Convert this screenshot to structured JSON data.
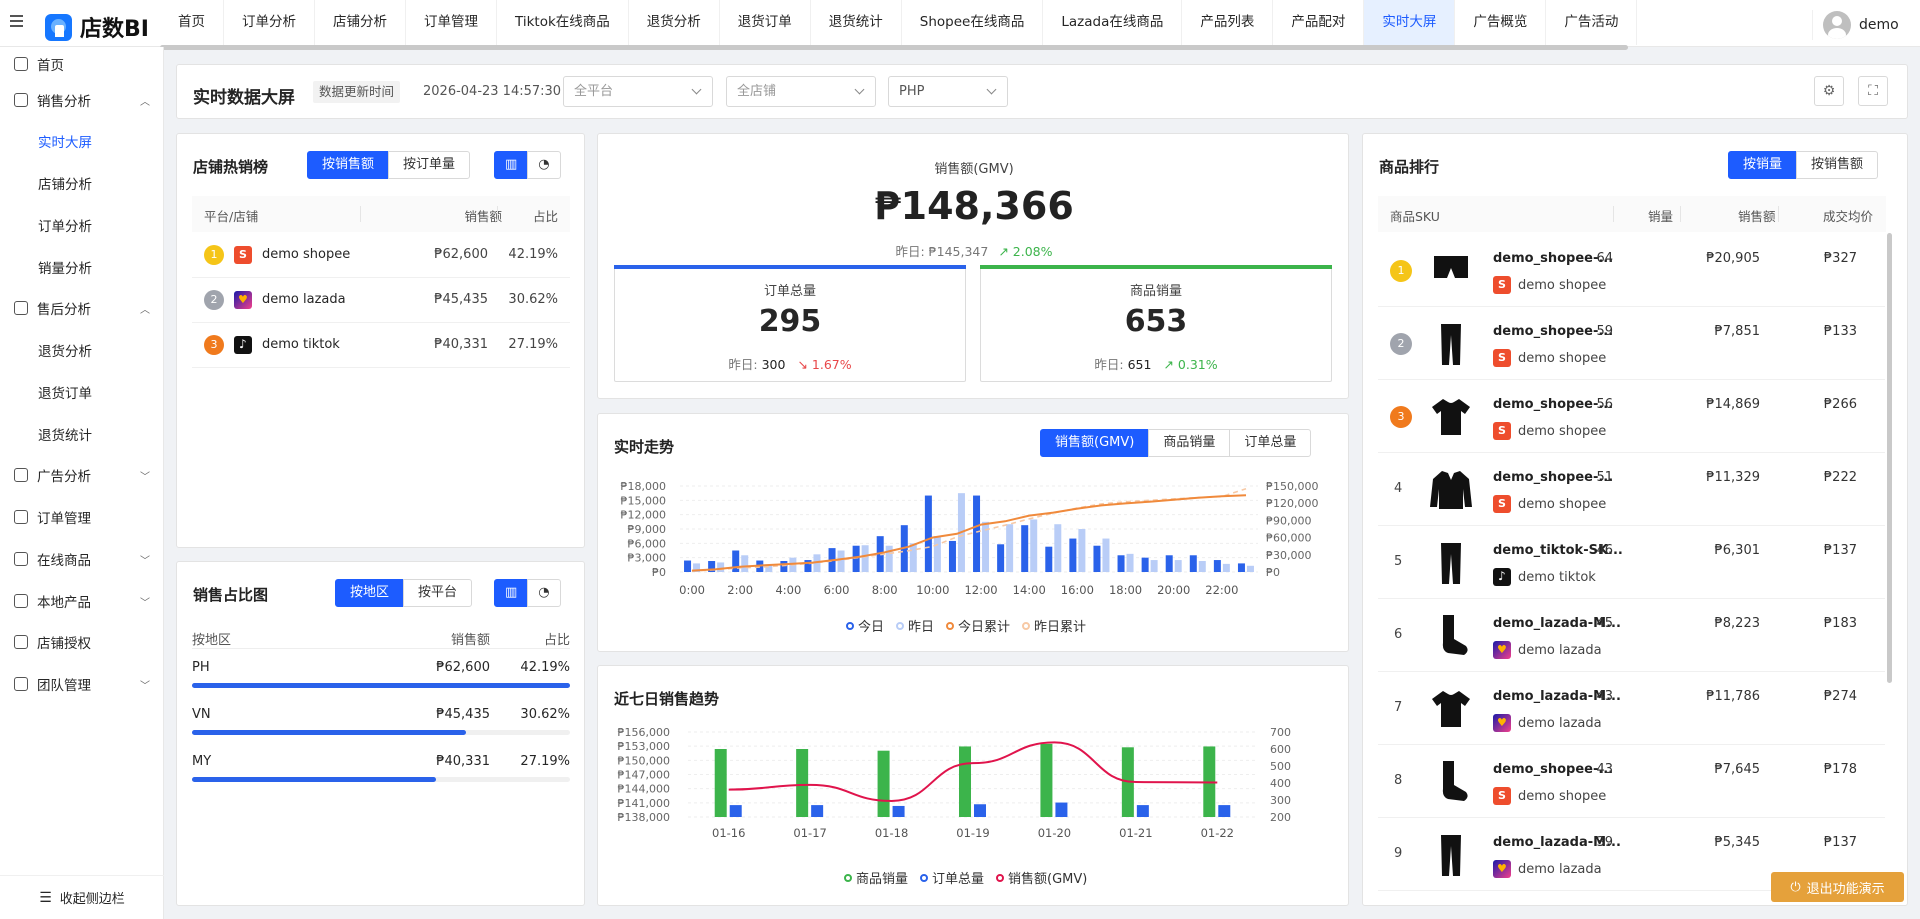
{
  "app": {
    "logo_text": "店数BI",
    "username": "demo"
  },
  "nav": [
    "首页",
    "订单分析",
    "店铺分析",
    "订单管理",
    "Tiktok在线商品",
    "退货分析",
    "退货订单",
    "退货统计",
    "Shopee在线商品",
    "Lazada在线商品",
    "产品列表",
    "产品配对",
    "实时大屏",
    "广告概览",
    "广告活动"
  ],
  "nav_active": "实时大屏",
  "sidebar": {
    "items": [
      {
        "label": "首页",
        "icon": "home-icon"
      },
      {
        "label": "销售分析",
        "icon": "sales-icon"
      },
      {
        "label": "实时大屏"
      },
      {
        "label": "店铺分析"
      },
      {
        "label": "订单分析"
      },
      {
        "label": "销量分析"
      },
      {
        "label": "售后分析",
        "icon": "aftersale-icon"
      },
      {
        "label": "退货分析"
      },
      {
        "label": "退货订单"
      },
      {
        "label": "退货统计"
      },
      {
        "label": "广告分析",
        "icon": "ad-icon"
      },
      {
        "label": "订单管理",
        "icon": "order-icon"
      },
      {
        "label": "在线商品",
        "icon": "store-icon"
      },
      {
        "label": "本地产品",
        "icon": "box-icon"
      },
      {
        "label": "店铺授权",
        "icon": "shield-icon"
      },
      {
        "label": "团队管理",
        "icon": "team-icon"
      }
    ],
    "collapse_label": "收起侧边栏"
  },
  "header": {
    "title": "实时数据大屏",
    "update_tag": "数据更新时间",
    "update_time": "2026-04-23 14:57:30",
    "platform_placeholder": "全平台",
    "shop_placeholder": "全店铺",
    "currency": "PHP"
  },
  "hot_shops": {
    "title": "店铺热销榜",
    "toggle": [
      "按销售额",
      "按订单量"
    ],
    "columns": [
      "平台/店铺",
      "销售额",
      "占比"
    ],
    "rows": [
      {
        "rank": "1",
        "platform": "shopee",
        "name": "demo shopee",
        "sales": "₱62,600",
        "pct": "42.19%"
      },
      {
        "rank": "2",
        "platform": "lazada",
        "name": "demo lazada",
        "sales": "₱45,435",
        "pct": "30.62%"
      },
      {
        "rank": "3",
        "platform": "tiktok",
        "name": "demo tiktok",
        "sales": "₱40,331",
        "pct": "27.19%"
      }
    ]
  },
  "share": {
    "title": "销售占比图",
    "toggle": [
      "按地区",
      "按平台"
    ],
    "columns": [
      "按地区",
      "销售额",
      "占比"
    ],
    "rows": [
      {
        "name": "PH",
        "sales": "₱62,600",
        "pct": "42.19%",
        "fraction": 0.4219
      },
      {
        "name": "VN",
        "sales": "₱45,435",
        "pct": "30.62%",
        "fraction": 0.3062
      },
      {
        "name": "MY",
        "sales": "₱40,331",
        "pct": "27.19%",
        "fraction": 0.2719
      }
    ]
  },
  "kpi": {
    "gmv_label": "销售额(GMV)",
    "gmv_value": "₱148,366",
    "gmv_yesterday": "昨日: ₱145,347",
    "gmv_change": "2.08%",
    "orders_label": "订单总量",
    "orders_value": "295",
    "orders_yesterday_label": "昨日:",
    "orders_yesterday": "300",
    "orders_change": "1.67%",
    "units_label": "商品销量",
    "units_value": "653",
    "units_yesterday_label": "昨日:",
    "units_yesterday": "651",
    "units_change": "0.31%",
    "colors": {
      "orders_bar": "#2a62ea",
      "units_bar": "#3cb44b"
    }
  },
  "realtime": {
    "title": "实时走势",
    "toggle": [
      "销售额(GMV)",
      "商品销量",
      "订单总量"
    ]
  },
  "weekly": {
    "title": "近七日销售趋势"
  },
  "ranking": {
    "title": "商品排行",
    "toggle": [
      "按销量",
      "按销售额"
    ],
    "columns": [
      "商品SKU",
      "销量",
      "销售额",
      "成交均价"
    ],
    "rows": [
      {
        "rank": "1",
        "img": "shorts-icon",
        "name": "demo_shopee-...",
        "platform": "shopee",
        "shop": "demo shopee",
        "qty": "64",
        "sales": "₱20,905",
        "avg": "₱327"
      },
      {
        "rank": "2",
        "img": "pants-icon",
        "name": "demo_shopee-...",
        "platform": "shopee",
        "shop": "demo shopee",
        "qty": "59",
        "sales": "₱7,851",
        "avg": "₱133"
      },
      {
        "rank": "3",
        "img": "tshirt-icon",
        "name": "demo_shopee-...",
        "platform": "shopee",
        "shop": "demo shopee",
        "qty": "56",
        "sales": "₱14,869",
        "avg": "₱266"
      },
      {
        "rank": "4",
        "img": "jacket-icon",
        "name": "demo_shopee-...",
        "platform": "shopee",
        "shop": "demo shopee",
        "qty": "51",
        "sales": "₱11,329",
        "avg": "₱222"
      },
      {
        "rank": "5",
        "img": "pants-icon",
        "name": "demo_tiktok-SK...",
        "platform": "tiktok",
        "shop": "demo tiktok",
        "qty": "46",
        "sales": "₱6,301",
        "avg": "₱137"
      },
      {
        "rank": "6",
        "img": "sock-icon",
        "name": "demo_lazada-M...",
        "platform": "lazada",
        "shop": "demo lazada",
        "qty": "45",
        "sales": "₱8,223",
        "avg": "₱183"
      },
      {
        "rank": "7",
        "img": "tshirt-icon",
        "name": "demo_lazada-M...",
        "platform": "lazada",
        "shop": "demo lazada",
        "qty": "43",
        "sales": "₱11,786",
        "avg": "₱274"
      },
      {
        "rank": "8",
        "img": "sock-icon",
        "name": "demo_shopee-...",
        "platform": "shopee",
        "shop": "demo shopee",
        "qty": "43",
        "sales": "₱7,645",
        "avg": "₱178"
      },
      {
        "rank": "9",
        "img": "pants-icon",
        "name": "demo_lazada-M...",
        "platform": "lazada",
        "shop": "demo lazada",
        "qty": "39",
        "sales": "₱5,345",
        "avg": "₱137"
      }
    ]
  },
  "exit_label": "退出功能演示",
  "chart_data": [
    {
      "type": "bar",
      "categories": [
        "0:00",
        "1:00",
        "2:00",
        "3:00",
        "4:00",
        "5:00",
        "6:00",
        "7:00",
        "8:00",
        "9:00",
        "10:00",
        "11:00",
        "12:00",
        "13:00",
        "14:00",
        "15:00",
        "16:00",
        "17:00",
        "18:00",
        "19:00",
        "20:00",
        "21:00",
        "22:00",
        "23:00"
      ],
      "x_tick_labels": [
        "0:00",
        "2:00",
        "4:00",
        "6:00",
        "8:00",
        "10:00",
        "12:00",
        "14:00",
        "16:00",
        "18:00",
        "20:00",
        "22:00"
      ],
      "series": [
        {
          "name": "今日",
          "color": "#2a62ea",
          "axis": "left",
          "values": [
            2400,
            2300,
            4500,
            2400,
            2300,
            2500,
            5000,
            5500,
            7500,
            9800,
            16000,
            6500,
            16000,
            5800,
            9800,
            5300,
            7000,
            5500,
            3500,
            3000,
            3500,
            3500,
            2500,
            1800
          ]
        },
        {
          "name": "昨日",
          "color": "#b9cdf7",
          "axis": "left",
          "values": [
            1800,
            2000,
            3500,
            1600,
            3000,
            3700,
            4500,
            5600,
            5500,
            6000,
            7500,
            16500,
            10500,
            10000,
            11000,
            10000,
            9000,
            7000,
            3800,
            2500,
            2500,
            2300,
            1700,
            1300
          ]
        },
        {
          "name": "今日累计",
          "color": "#f08a3c",
          "axis": "right",
          "type": "line",
          "values": [
            2400,
            4700,
            9200,
            11600,
            13900,
            16400,
            21400,
            26900,
            34400,
            44200,
            60200,
            66700,
            82700,
            88500,
            98300,
            103600,
            110600,
            116100,
            119600,
            122600,
            126100,
            129600,
            132100,
            133900
          ]
        },
        {
          "name": "昨日累计",
          "color": "#f7c9a5",
          "axis": "right",
          "type": "line",
          "dashed": true,
          "values": [
            1800,
            3800,
            7300,
            8900,
            11900,
            15600,
            20100,
            25700,
            31200,
            37200,
            44700,
            61200,
            71700,
            81700,
            92700,
            102700,
            111700,
            118700,
            122500,
            125000,
            127500,
            129800,
            131500,
            145347
          ]
        }
      ],
      "y_left": {
        "ticks": [
          "₱0",
          "₱3,000",
          "₱6,000",
          "₱9,000",
          "₱12,000",
          "₱15,000",
          "₱18,000"
        ],
        "range": [
          0,
          18000
        ]
      },
      "y_right": {
        "ticks": [
          "₱0",
          "₱30,000",
          "₱60,000",
          "₱90,000",
          "₱120,000",
          "₱150,000"
        ],
        "range": [
          0,
          150000
        ]
      }
    },
    {
      "type": "bar",
      "categories": [
        "01-16",
        "01-17",
        "01-18",
        "01-19",
        "01-20",
        "01-21",
        "01-22"
      ],
      "series": [
        {
          "name": "商品销量",
          "color": "#3cb44b",
          "axis": "right",
          "values": [
            600,
            600,
            590,
            615,
            630,
            610,
            615
          ]
        },
        {
          "name": "订单总量",
          "color": "#2a62ea",
          "axis": "right",
          "values": [
            270,
            270,
            265,
            275,
            285,
            270,
            270
          ]
        },
        {
          "name": "销售额(GMV)",
          "color": "#e0144c",
          "axis": "left",
          "type": "line",
          "values": [
            143800,
            144800,
            141400,
            149400,
            153800,
            145400,
            145300
          ]
        }
      ],
      "y_left": {
        "ticks": [
          "₱138,000",
          "₱141,000",
          "₱144,000",
          "₱147,000",
          "₱150,000",
          "₱153,000",
          "₱156,000"
        ],
        "range": [
          138000,
          156000
        ]
      },
      "y_right": {
        "ticks": [
          "200",
          "300",
          "400",
          "500",
          "600",
          "700"
        ],
        "range": [
          200,
          700
        ]
      }
    }
  ]
}
